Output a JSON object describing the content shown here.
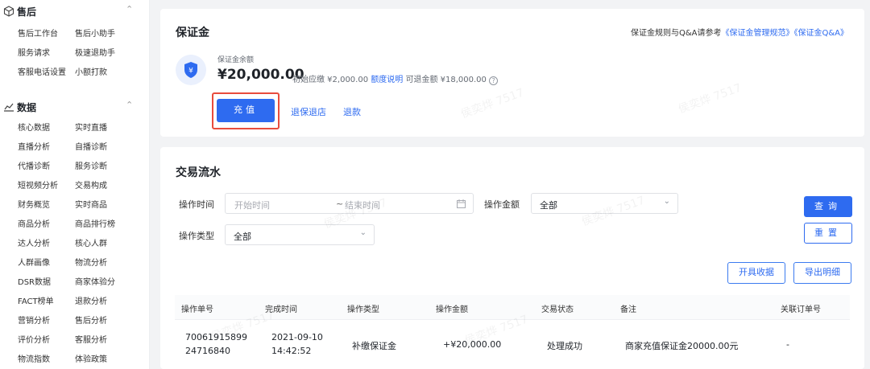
{
  "sidebar": {
    "aftersales": {
      "title": "售后",
      "items": [
        "售后工作台",
        "售后小助手",
        "服务请求",
        "极速退助手",
        "客服电话设置",
        "小额打款"
      ]
    },
    "data": {
      "title": "数据",
      "items": [
        "核心数据",
        "实时直播",
        "直播分析",
        "自播诊断",
        "代播诊断",
        "服务诊断",
        "短视频分析",
        "交易构成",
        "财务概览",
        "实时商品",
        "商品分析",
        "商品排行榜",
        "达人分析",
        "核心人群",
        "人群画像",
        "物流分析",
        "DSR数据",
        "商家体验分",
        "FACT榜单",
        "退款分析",
        "营销分析",
        "售后分析",
        "评价分析",
        "客服分析",
        "物流指数",
        "体验政策"
      ]
    }
  },
  "deposit": {
    "title": "保证金",
    "rules_prefix": "保证金规则与Q&A请参考",
    "rules_link1": "《保证金管理规范》",
    "rules_link2": "《保证金Q&A》",
    "balance_label": "保证金余额",
    "balance_amount": "¥20,000.00",
    "initial_due": "初始应缴 ¥2,000.00",
    "quota_link": "额度说明",
    "refundable": "可退金额 ¥18,000.00",
    "recharge_label": "充值",
    "withdraw_store_label": "退保退店",
    "refund_label": "退款"
  },
  "transactions": {
    "title": "交易流水",
    "filters": {
      "time_label": "操作时间",
      "start_placeholder": "开始时间",
      "separator": "~",
      "end_placeholder": "结束时间",
      "amount_label": "操作金额",
      "amount_value": "全部",
      "type_label": "操作类型",
      "type_value": "全部"
    },
    "query_label": "查询",
    "reset_label": "重置",
    "invoice_label": "开具收据",
    "export_label": "导出明细",
    "columns": [
      "操作单号",
      "完成时间",
      "操作类型",
      "操作金额",
      "交易状态",
      "备注",
      "关联订单号"
    ],
    "rows": [
      {
        "order_no_line1": "70061915899",
        "order_no_line2": "24716840",
        "date": "2021-09-10",
        "time": "14:42:52",
        "type": "补缴保证金",
        "amount": "+¥20,000.00",
        "status": "处理成功",
        "note": "商家充值保证金20000.00元",
        "related": "-"
      }
    ]
  },
  "watermark": "侯奕烨 7517",
  "colors": {
    "primary": "#2e6bf0",
    "highlight": "#e84c3d"
  }
}
